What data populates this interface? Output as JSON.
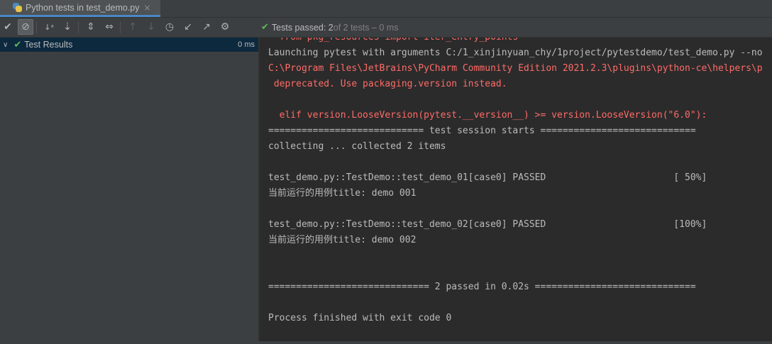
{
  "tab": {
    "title": "Python tests in test_demo.py",
    "close": "×",
    "icon": "python-icon"
  },
  "toolbar": {
    "buttons": [
      {
        "icon": "show-passed-icon",
        "glyph": "✔"
      },
      {
        "icon": "show-ignored-icon",
        "glyph": "⊘"
      },
      {
        "icon": "sort-alphabetically-icon",
        "glyph": "↓ᵃ"
      },
      {
        "icon": "sort-by-duration-icon",
        "glyph": "⇣"
      },
      {
        "icon": "expand-all-icon",
        "glyph": "⇕"
      },
      {
        "icon": "collapse-all-icon",
        "glyph": "⇔"
      },
      {
        "icon": "previous-failed-icon",
        "glyph": "↑"
      },
      {
        "icon": "next-failed-icon",
        "glyph": "↓"
      },
      {
        "icon": "test-history-icon",
        "glyph": "◷"
      },
      {
        "icon": "import-tests-icon",
        "glyph": "↙"
      },
      {
        "icon": "export-tests-icon",
        "glyph": "↗"
      },
      {
        "icon": "settings-gear-icon",
        "glyph": "⚙"
      }
    ]
  },
  "status": {
    "check": "✔",
    "text": "Tests passed: 2",
    "sub": " of 2 tests – 0 ms"
  },
  "tree": {
    "chevron": "∨",
    "check": "✔",
    "label": "Test Results",
    "duration": "0 ms"
  },
  "console": {
    "lines": [
      {
        "text": "  from pkg_resources import iter_entry_points",
        "kind": "err"
      },
      {
        "text": "Launching pytest with arguments C:/1_xinjinyuan_chy/1project/pytestdemo/test_demo.py --no",
        "kind": "out"
      },
      {
        "text": "C:\\Program Files\\JetBrains\\PyCharm Community Edition 2021.2.3\\plugins\\python-ce\\helpers\\p",
        "kind": "err"
      },
      {
        "text": " deprecated. Use packaging.version instead.",
        "kind": "err"
      },
      {
        "text": "",
        "kind": "out"
      },
      {
        "text": "  elif version.LooseVersion(pytest.__version__) >= version.LooseVersion(\"6.0\"):",
        "kind": "err"
      },
      {
        "text": "============================ test session starts ============================",
        "kind": "out"
      },
      {
        "text": "collecting ... collected 2 items",
        "kind": "out"
      },
      {
        "text": "",
        "kind": "out"
      },
      {
        "text": "test_demo.py::TestDemo::test_demo_01[case0] PASSED                       [ 50%]",
        "kind": "out"
      },
      {
        "text": "当前运行的用例title: demo 001",
        "kind": "out"
      },
      {
        "text": "",
        "kind": "out"
      },
      {
        "text": "test_demo.py::TestDemo::test_demo_02[case0] PASSED                       [100%]",
        "kind": "out"
      },
      {
        "text": "当前运行的用例title: demo 002",
        "kind": "out"
      },
      {
        "text": "",
        "kind": "out"
      },
      {
        "text": "",
        "kind": "out"
      },
      {
        "text": "============================= 2 passed in 0.02s =============================",
        "kind": "out"
      },
      {
        "text": "",
        "kind": "out"
      },
      {
        "text": "Process finished with exit code 0",
        "kind": "out"
      }
    ]
  },
  "colors": {
    "accent": "#4a88c7",
    "pass": "#5fb85f",
    "stderr": "#ff6b68",
    "text": "#bbbbbb"
  }
}
